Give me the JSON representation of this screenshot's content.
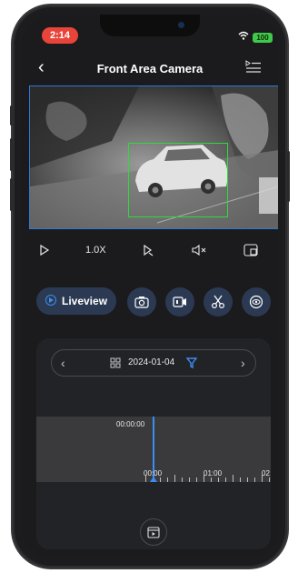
{
  "status_bar": {
    "time": "2:14",
    "battery": "100"
  },
  "header": {
    "title": "Front Area Camera"
  },
  "video_controls": {
    "speed": "1.0X"
  },
  "actions": {
    "liveview_label": "Liveview"
  },
  "timeline": {
    "date": "2024-01-04",
    "cursor_time": "00:00:00",
    "tick_labels": [
      "00:00",
      "01:00",
      "02"
    ]
  },
  "colors": {
    "accent": "#3d8cf0",
    "detection_box": "#2edb3a",
    "time_pill": "#e8443a",
    "battery": "#3fc84a"
  },
  "icons": [
    "back-arrow-icon",
    "playlist-icon",
    "play-icon",
    "step-play-icon",
    "mute-icon",
    "split-screen-icon",
    "camera-icon",
    "record-icon",
    "scissors-icon",
    "eye-icon",
    "grid-icon",
    "filter-icon",
    "calendar-play-icon"
  ]
}
